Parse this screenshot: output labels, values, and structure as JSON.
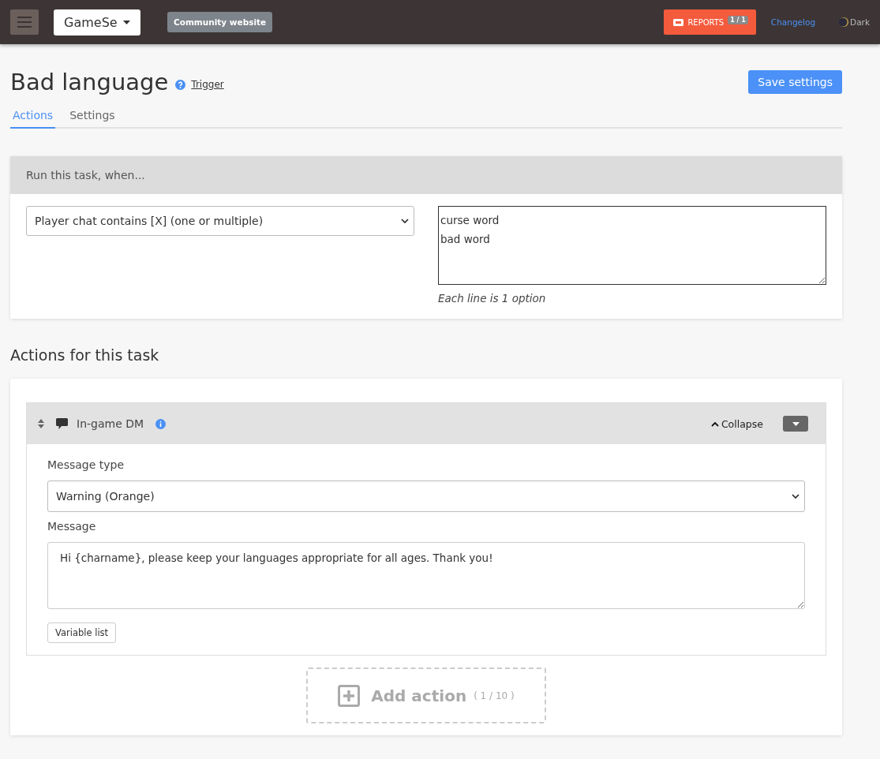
{
  "header": {
    "server": "GameSe",
    "community": "Community website",
    "reports": {
      "label": "REPORTS",
      "badge": "1 / 1"
    },
    "changelog": "Changelog",
    "theme": "Dark"
  },
  "page": {
    "title": "Bad language",
    "link": "Trigger",
    "save": "Save settings"
  },
  "tabs": [
    {
      "label": "Actions",
      "selected": true
    },
    {
      "label": "Settings",
      "selected": false
    }
  ],
  "trigger_panel": {
    "heading": "Run this task, when...",
    "condition": "Player chat contains [X] (one or multiple)",
    "options": "curse word\nbad word",
    "hint": "Each line is 1 option"
  },
  "actions_heading": "Actions for this task",
  "actions": [
    {
      "title": "In-game DM",
      "expanded": true,
      "toggle": "Collapse",
      "variable_button": "Variable list",
      "fields": [
        {
          "kind": "select",
          "label": "Message type",
          "value": "Warning (Orange)"
        },
        {
          "kind": "textarea",
          "label": "Message",
          "value": "Hi {charname}, please keep your languages appropriate for all ages. Thank you!"
        }
      ]
    }
  ],
  "add_action": {
    "label": "Add action",
    "count": "( 1 / 10 )"
  }
}
